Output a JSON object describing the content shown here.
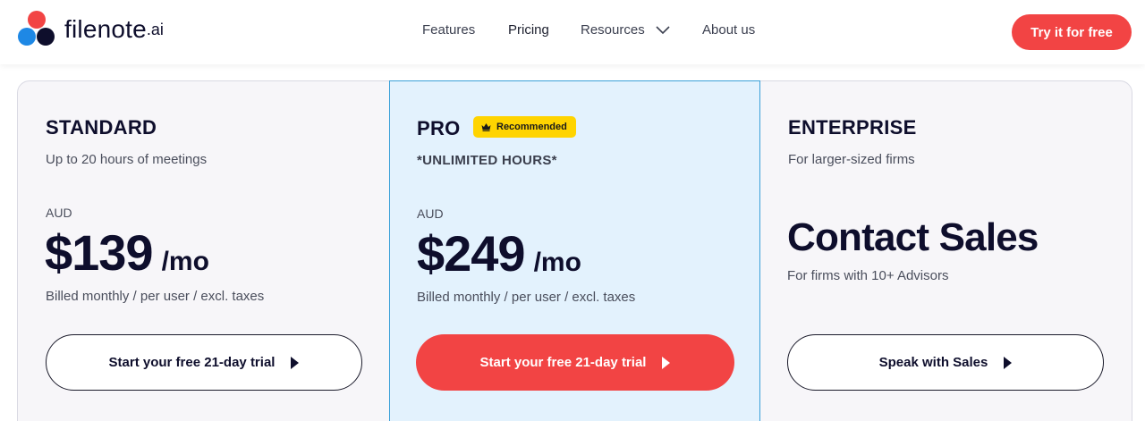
{
  "brand": {
    "name": "filenote",
    "suffix": ".ai",
    "colors": {
      "red": "#f24444",
      "blue": "#1e88e5",
      "navy": "#0e0e2c"
    }
  },
  "nav": {
    "items": [
      {
        "label": "Features"
      },
      {
        "label": "Pricing"
      },
      {
        "label": "Resources",
        "icon": "chevron-down-icon"
      },
      {
        "label": "About us"
      }
    ],
    "cta": "Try it for free"
  },
  "plans": [
    {
      "name": "STANDARD",
      "subtitle": "Up to 20 hours of meetings",
      "currency": "AUD",
      "price": "$139",
      "period": "/mo",
      "billing": "Billed monthly / per user / excl. taxes",
      "button": "Start your free 21-day trial"
    },
    {
      "name": "PRO",
      "badge": "Recommended",
      "badge_icon": "crown-icon",
      "subtitle": "*UNLIMITED HOURS*",
      "currency": "AUD",
      "price": "$249",
      "period": "/mo",
      "billing": "Billed monthly / per user / excl. taxes",
      "button": "Start your free 21-day trial"
    },
    {
      "name": "ENTERPRISE",
      "subtitle": "For larger-sized firms",
      "headline": "Contact Sales",
      "note": "For firms with 10+ Advisors",
      "button": "Speak with Sales"
    }
  ],
  "accent": "#f24444",
  "highlight_bg": "#e3f2fd",
  "badge_color": "#ffd400"
}
